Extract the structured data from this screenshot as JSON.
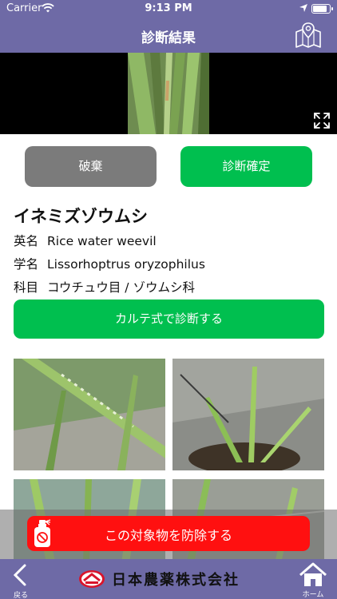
{
  "status_bar": {
    "carrier": "Carrier",
    "time": "9:13 PM",
    "battery_level": 0.9
  },
  "nav": {
    "title": "診断結果",
    "map_icon": "map-pin-icon"
  },
  "photo": {
    "expand_icon": "expand-icon"
  },
  "actions": {
    "discard_label": "破棄",
    "confirm_label": "診断確定"
  },
  "result": {
    "name": "イネミズゾウムシ",
    "rows": [
      {
        "label": "英名",
        "value": "Rice water weevil"
      },
      {
        "label": "学名",
        "value": "Lissorhoptrus oryzophilus"
      },
      {
        "label": "科目",
        "value": "コウチュウ目 / ゾウムシ科"
      }
    ]
  },
  "karte_button_label": "カルテ式で診断する",
  "prevent_button_label": "この対象物を防除する",
  "footer": {
    "back_label": "戻る",
    "brand_name": "日本農薬株式会社",
    "home_label": "ホーム"
  },
  "colors": {
    "nav": "#6e6aa6",
    "green": "#00bf4f",
    "gray": "#7b7b7b",
    "red": "#ff1010"
  }
}
